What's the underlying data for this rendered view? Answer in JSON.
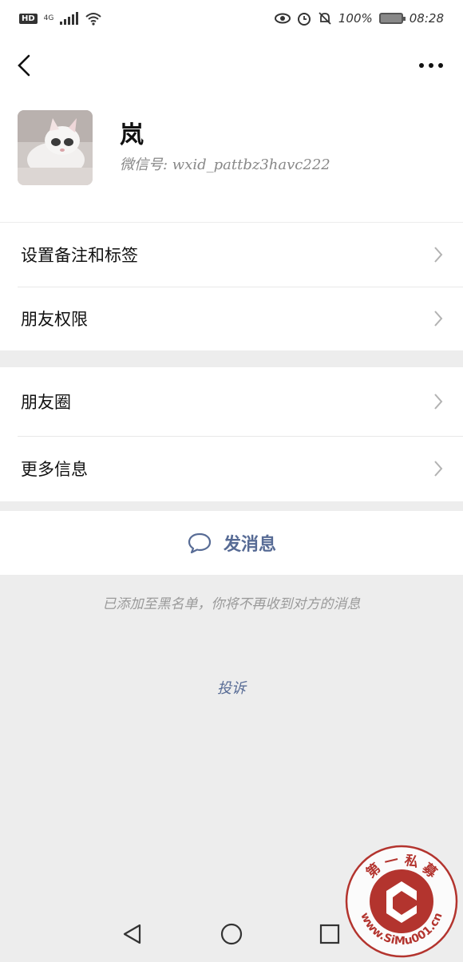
{
  "status_bar": {
    "network_badge": "HD",
    "network_type": "4G",
    "battery": "100%",
    "time": "08:28",
    "icons": [
      "eye-icon",
      "alarm-icon",
      "bell-off-icon",
      "battery-icon"
    ]
  },
  "profile": {
    "name": "岚",
    "wechat_id": "微信号: wxid_pattbz3havc222"
  },
  "group1": [
    {
      "label": "设置备注和标签"
    },
    {
      "label": "朋友权限"
    }
  ],
  "group2": [
    {
      "label": "朋友圈"
    },
    {
      "label": "更多信息"
    }
  ],
  "send_message": {
    "label": "发消息",
    "icon": "chat-bubble-icon"
  },
  "blocked_notice": "已添加至黑名单，你将不再收到对方的消息",
  "complain": "投诉",
  "watermark": {
    "text_top": "第 一 私 募",
    "text_bottom": "www.SiMu001.cn"
  },
  "colors": {
    "link": "#576b95",
    "background": "#ededed",
    "seal_red": "#b3342e"
  }
}
